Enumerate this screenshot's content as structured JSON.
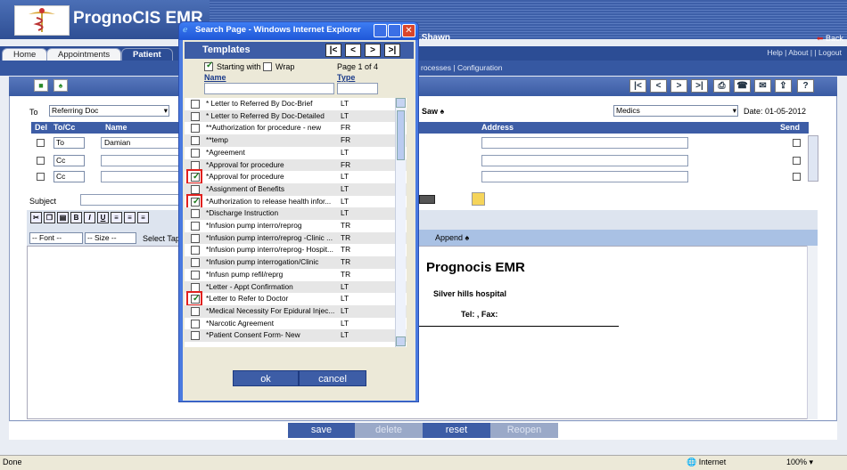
{
  "app": {
    "title": "PrognoCIS EMR",
    "user": ".Shawn",
    "back_label": "Back",
    "top_links": "Help | About | | Logout"
  },
  "tabs": [
    "Home",
    "Appointments",
    "Patient"
  ],
  "subnav": "rocesses | Configuration",
  "form": {
    "to_label": "To",
    "to_value": "Referring Doc",
    "saw_label": "Saw",
    "medics_value": "Medics",
    "date_label": "Date: 01-05-2012",
    "subject_label": "Subject",
    "grid_headers": {
      "del": "Del",
      "tocc": "To/Cc",
      "name": "Name",
      "address": "Address",
      "send": "Send"
    },
    "rows": [
      {
        "tocc": "To",
        "name": "Damian"
      },
      {
        "tocc": "Cc",
        "name": ""
      },
      {
        "tocc": "Cc",
        "name": ""
      }
    ],
    "font_select": "-- Font --",
    "size_select": "-- Size --",
    "select_tap": "Select Tap",
    "append_label": "Append"
  },
  "preview": {
    "title": "Prognocis EMR",
    "hospital": "Silver hills hospital",
    "tel": "Tel: , Fax:"
  },
  "actions": {
    "save": "save",
    "delete": "delete",
    "reset": "reset",
    "reopen": "Reopen"
  },
  "status": {
    "left": "Done",
    "zone": "Internet",
    "zoom": "100%"
  },
  "dialog": {
    "window_title": "Search Page - Windows Internet Explorer",
    "header": "Templates",
    "starting_with": "Starting with",
    "wrap": "Wrap",
    "page_info": "Page 1 of 4",
    "col_name": "Name",
    "col_type": "Type",
    "ok": "ok",
    "cancel": "cancel",
    "templates": [
      {
        "name": "* Letter to Referred By Doc-Brief",
        "type": "LT",
        "checked": false
      },
      {
        "name": "* Letter to Referred By Doc-Detailed",
        "type": "LT",
        "checked": false
      },
      {
        "name": "**Authorization for procedure - new",
        "type": "FR",
        "checked": false
      },
      {
        "name": "**temp",
        "type": "FR",
        "checked": false
      },
      {
        "name": "*Agreement",
        "type": "LT",
        "checked": false
      },
      {
        "name": "*Approval for procedure",
        "type": "FR",
        "checked": false
      },
      {
        "name": "*Approval for procedure",
        "type": "LT",
        "checked": true
      },
      {
        "name": "*Assignment of Benefits",
        "type": "LT",
        "checked": false
      },
      {
        "name": "*Authorization to release health infor...",
        "type": "LT",
        "checked": true
      },
      {
        "name": "*Discharge Instruction",
        "type": "LT",
        "checked": false
      },
      {
        "name": "*Infusion pump interro/reprog",
        "type": "TR",
        "checked": false
      },
      {
        "name": "*Infusion pump interro/reprog -Clinic ...",
        "type": "TR",
        "checked": false
      },
      {
        "name": "*Infusion pump interro/reprog- Hospit...",
        "type": "TR",
        "checked": false
      },
      {
        "name": "*Infusion pump interrogation/Clinic",
        "type": "TR",
        "checked": false
      },
      {
        "name": "*Infusn pump refil/reprg",
        "type": "TR",
        "checked": false
      },
      {
        "name": "*Letter - Appt Confirmation",
        "type": "LT",
        "checked": false
      },
      {
        "name": "*Letter to Refer to Doctor",
        "type": "LT",
        "checked": true
      },
      {
        "name": "*Medical Necessity For Epidural Injec...",
        "type": "LT",
        "checked": false
      },
      {
        "name": "*Narcotic Agreement",
        "type": "LT",
        "checked": false
      },
      {
        "name": "*Patient Consent Form- New",
        "type": "LT",
        "checked": false
      }
    ]
  }
}
